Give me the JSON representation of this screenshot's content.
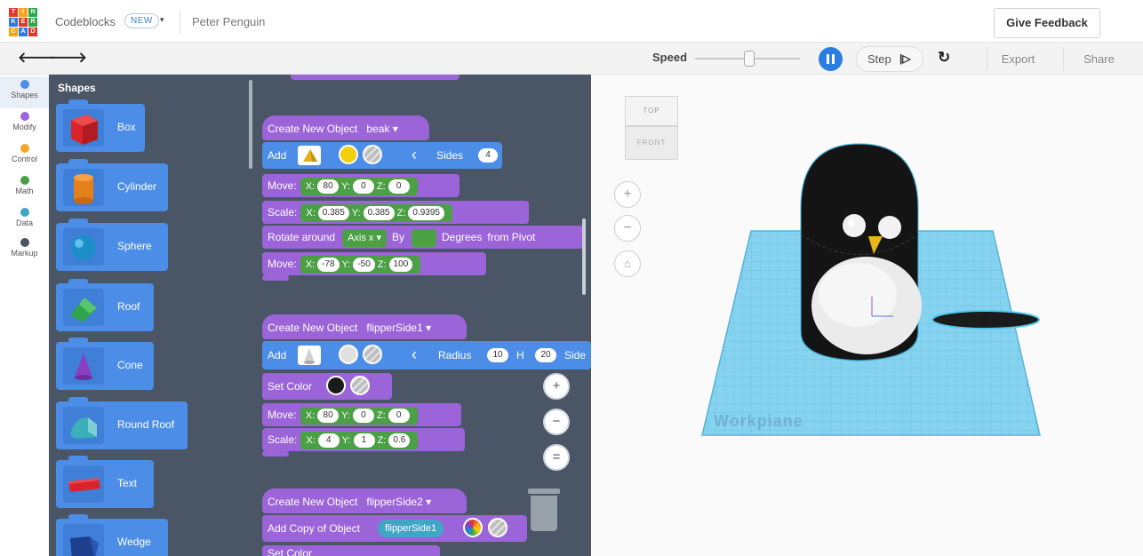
{
  "header": {
    "app_name": "Codeblocks",
    "new_badge": "NEW",
    "caret": "▾",
    "project_name": "Peter Penguin",
    "feedback_label": "Give Feedback"
  },
  "toolbar": {
    "undo_icon": "🡐",
    "redo_icon": "🡒",
    "speed_label": "Speed",
    "step_label": "Step",
    "step_icon": "|▷",
    "reset_icon": "↻",
    "export_label": "Export",
    "share_label": "Share"
  },
  "categories": [
    {
      "label": "Shapes",
      "color": "#4c8ee7"
    },
    {
      "label": "Modify",
      "color": "#9c64d9"
    },
    {
      "label": "Control",
      "color": "#f2a623"
    },
    {
      "label": "Math",
      "color": "#4ba045"
    },
    {
      "label": "Data",
      "color": "#40a6c6"
    },
    {
      "label": "Markup",
      "color": "#4a5566"
    }
  ],
  "flyout": {
    "title": "Shapes",
    "items": [
      {
        "label": "Box",
        "icon": "box-icon"
      },
      {
        "label": "Cylinder",
        "icon": "cylinder-icon"
      },
      {
        "label": "Sphere",
        "icon": "sphere-icon"
      },
      {
        "label": "Roof",
        "icon": "roof-icon"
      },
      {
        "label": "Cone",
        "icon": "cone-icon"
      },
      {
        "label": "Round Roof",
        "icon": "round-roof-icon"
      },
      {
        "label": "Text",
        "icon": "text-shape-icon"
      },
      {
        "label": "Wedge",
        "icon": "wedge-icon"
      }
    ]
  },
  "script": {
    "beak": {
      "create_label": "Create New Object",
      "object_name": "beak",
      "add_label": "Add",
      "sides_label": "Sides",
      "sides_value": "4",
      "move_label": "Move:",
      "move": {
        "x": "80",
        "y": "0",
        "z": "0"
      },
      "scale_label": "Scale:",
      "scale": {
        "x": "0.385",
        "y": "0.385",
        "z": "0.9395"
      },
      "rotate_label": "Rotate around",
      "rotate_axis": "Axis x",
      "rotate_by": "By",
      "rotate_degrees": "Degrees",
      "rotate_pivot": "from Pivot",
      "move2": {
        "x": "-78",
        "y": "-50",
        "z": "100"
      }
    },
    "flipper1": {
      "create_label": "Create New Object",
      "object_name": "flipperSide1",
      "add_label": "Add",
      "radius_label": "Radius",
      "radius_value": "10",
      "h_label": "H",
      "h_value": "20",
      "sides_label": "Side",
      "set_color_label": "Set Color",
      "move_label": "Move:",
      "move": {
        "x": "80",
        "y": "0",
        "z": "0"
      },
      "scale_label": "Scale:",
      "scale": {
        "x": "4",
        "y": "1",
        "z": "0.6"
      }
    },
    "flipper2": {
      "create_label": "Create New Object",
      "object_name": "flipperSide2",
      "add_copy_label": "Add Copy of Object",
      "copy_source": "flipperSide1",
      "set_color_label": "Set Color"
    },
    "axis_labels": {
      "x": "X:",
      "y": "Y:",
      "z": "Z:"
    }
  },
  "viewport": {
    "cube_top": "TOP",
    "cube_front": "FRONT",
    "zoom_in": "+",
    "zoom_out": "−",
    "home": "⌂",
    "workplane_label": "Workpiane"
  },
  "colors": {
    "accent_blue": "#2b7ee0",
    "block_blue": "#4c8ee7",
    "block_purple": "#9c64d9",
    "block_green": "#4ba045",
    "workspace_bg": "#4a5566",
    "workplane": "#86d3ef"
  }
}
